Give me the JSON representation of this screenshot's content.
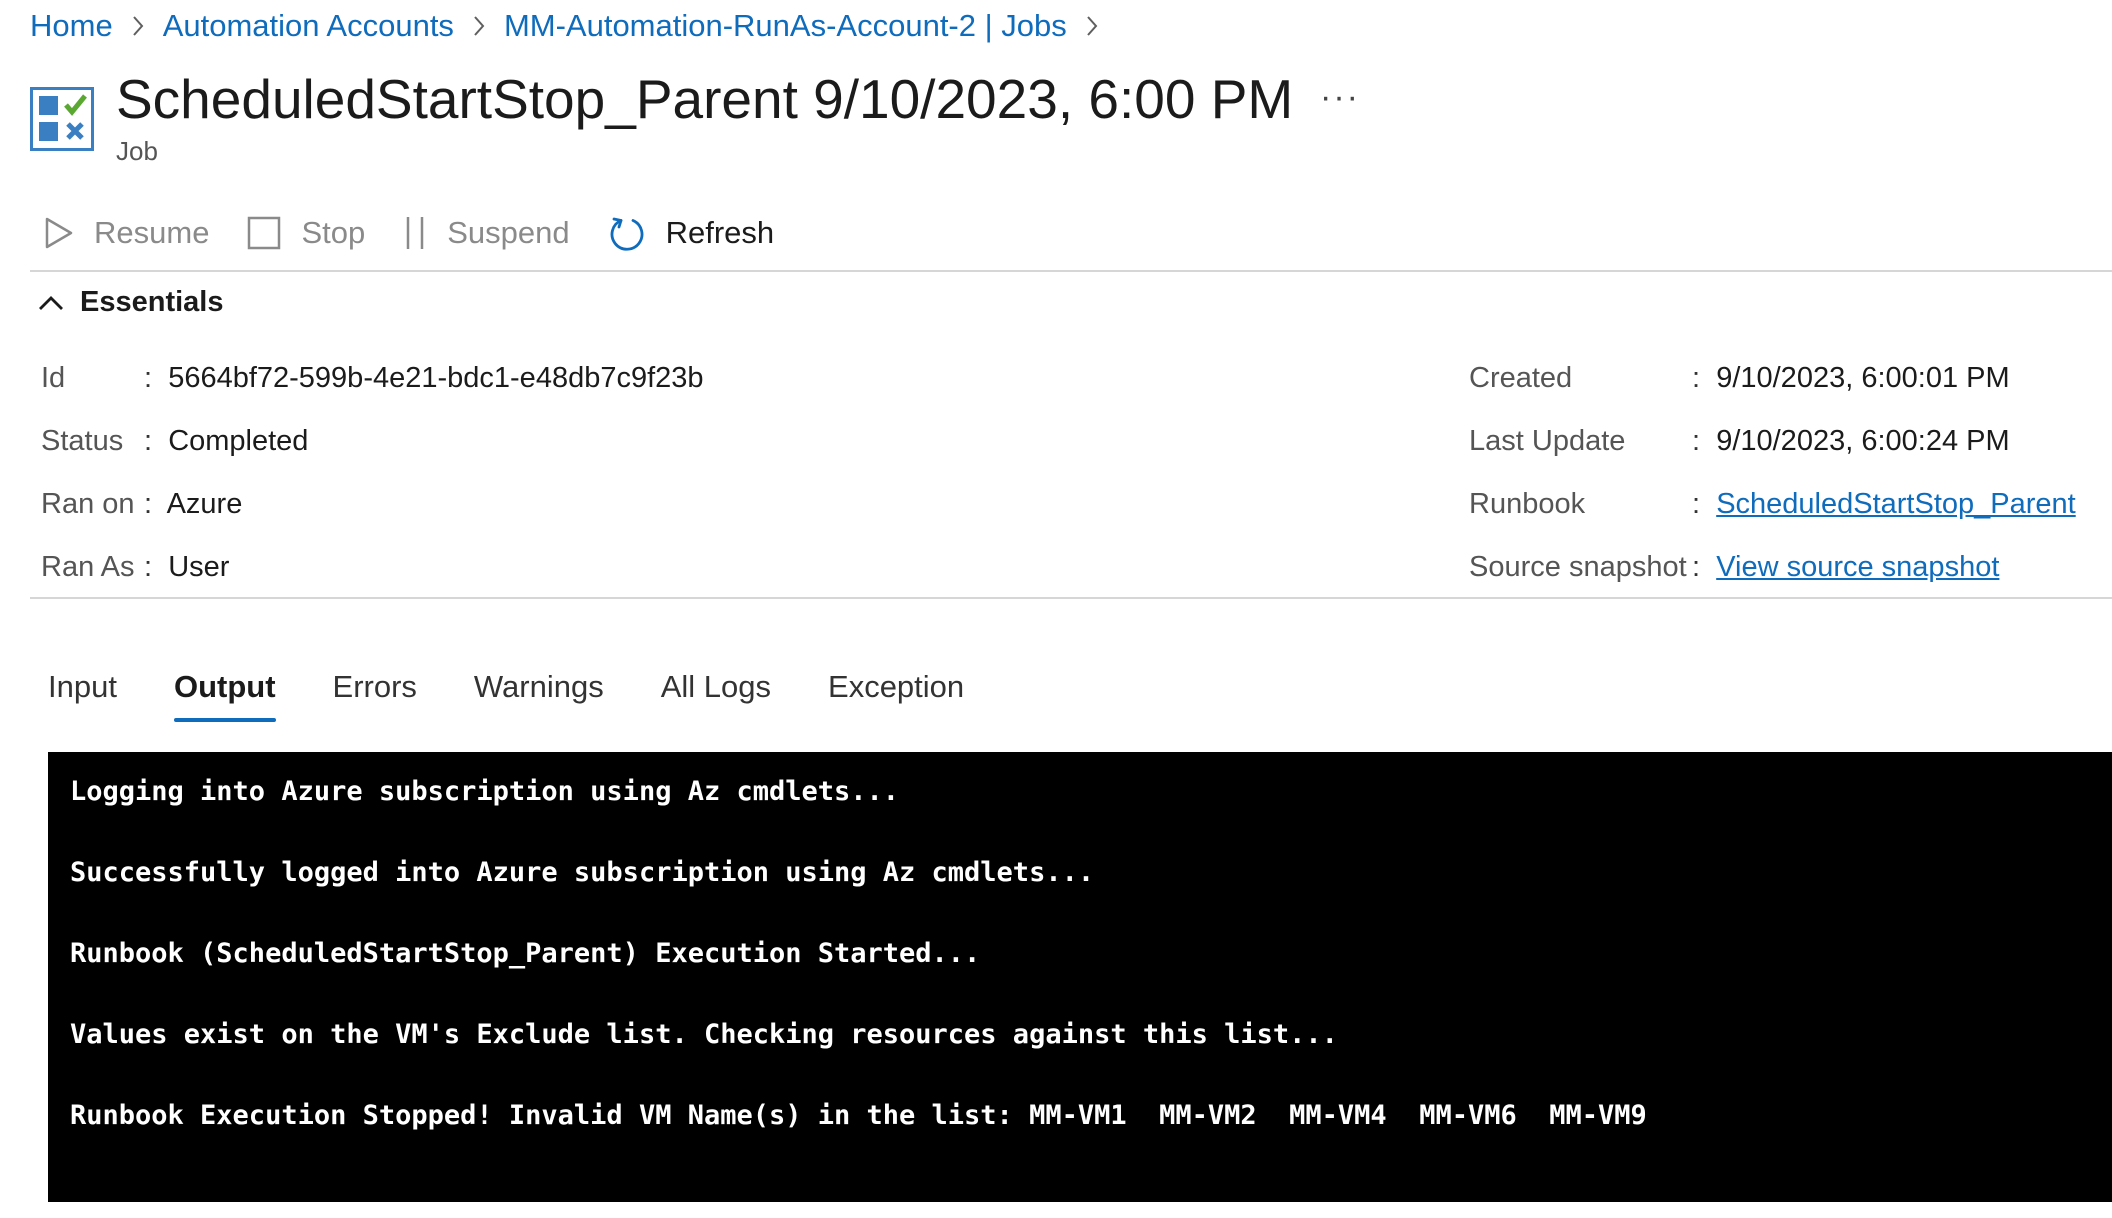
{
  "breadcrumb": {
    "items": [
      "Home",
      "Automation Accounts",
      "MM-Automation-RunAs-Account-2 | Jobs"
    ]
  },
  "header": {
    "title": "ScheduledStartStop_Parent 9/10/2023, 6:00 PM",
    "subtitle": "Job",
    "more_label": "···",
    "icon": "job-icon"
  },
  "toolbar": {
    "resume_label": "Resume",
    "stop_label": "Stop",
    "suspend_label": "Suspend",
    "refresh_label": "Refresh"
  },
  "essentials": {
    "toggle_label": "Essentials",
    "left": [
      {
        "label": "Id",
        "value": "5664bf72-599b-4e21-bdc1-e48db7c9f23b"
      },
      {
        "label": "Status",
        "value": "Completed"
      },
      {
        "label": "Ran on",
        "value": "Azure"
      },
      {
        "label": "Ran As",
        "value": "User"
      }
    ],
    "right": [
      {
        "label": "Created",
        "value": "9/10/2023, 6:00:01 PM"
      },
      {
        "label": "Last Update",
        "value": "9/10/2023, 6:00:24 PM"
      },
      {
        "label": "Runbook",
        "value": "ScheduledStartStop_Parent"
      },
      {
        "label": "Source snapshot",
        "value": "View source snapshot"
      }
    ],
    "colon": ":"
  },
  "tabs": [
    "Input",
    "Output",
    "Errors",
    "Warnings",
    "All Logs",
    "Exception"
  ],
  "active_tab": "Output",
  "output": {
    "lines": [
      "Logging into Azure subscription using Az cmdlets...",
      "Successfully logged into Azure subscription using Az cmdlets...",
      "Runbook (ScheduledStartStop_Parent) Execution Started...",
      "Values exist on the VM's Exclude list. Checking resources against this list...",
      "Runbook Execution Stopped! Invalid VM Name(s) in the list: MM-VM1  MM-VM2  MM-VM4  MM-VM6  MM-VM9"
    ]
  },
  "colors": {
    "link": "#0f6cbd",
    "console_bg": "#000000",
    "console_text": "#ffffff",
    "icon_blue": "#3a7fc1",
    "icon_green": "#5aa832"
  }
}
